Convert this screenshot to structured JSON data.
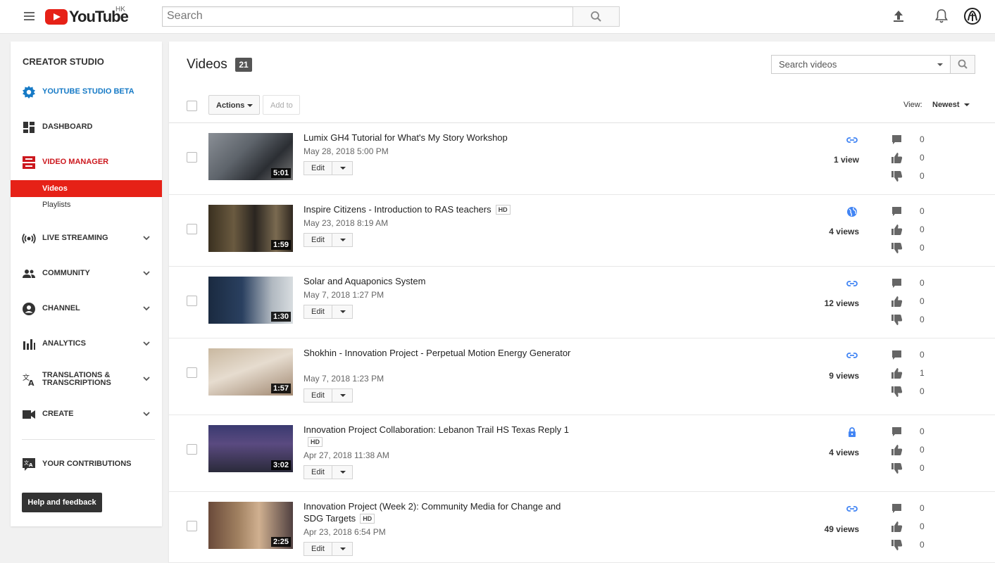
{
  "header": {
    "logo_text": "YouTube",
    "region": "HK",
    "search_placeholder": "Search"
  },
  "sidebar": {
    "title": "CREATOR STUDIO",
    "studio_beta": "YOUTUBE STUDIO BETA",
    "dashboard": "DASHBOARD",
    "video_manager": "VIDEO MANAGER",
    "videos": "Videos",
    "playlists": "Playlists",
    "live_streaming": "LIVE STREAMING",
    "community": "COMMUNITY",
    "channel": "CHANNEL",
    "analytics": "ANALYTICS",
    "translations_line1": "TRANSLATIONS &",
    "translations_line2": "TRANSCRIPTIONS",
    "create": "CREATE",
    "your_contributions": "YOUR CONTRIBUTIONS",
    "help_feedback": "Help and feedback"
  },
  "main": {
    "title": "Videos",
    "count": "21",
    "search_videos_placeholder": "Search videos",
    "actions_label": "Actions",
    "add_to_label": "Add to",
    "view_label": "View:",
    "view_value": "Newest",
    "edit_label": "Edit",
    "hd_label": "HD"
  },
  "videos": [
    {
      "title": "Lumix GH4 Tutorial for What's My Story Workshop",
      "hd": false,
      "date": "May 28, 2018 5:00 PM",
      "duration": "5:01",
      "privacy": "unlisted",
      "views": "1 view",
      "comments": "0",
      "likes": "0",
      "dislikes": "0"
    },
    {
      "title": "Inspire Citizens - Introduction to RAS teachers",
      "hd": true,
      "date": "May 23, 2018 8:19 AM",
      "duration": "1:59",
      "privacy": "public",
      "views": "4 views",
      "comments": "0",
      "likes": "0",
      "dislikes": "0"
    },
    {
      "title": "Solar and Aquaponics System",
      "hd": false,
      "date": "May 7, 2018 1:27 PM",
      "duration": "1:30",
      "privacy": "unlisted",
      "views": "12 views",
      "comments": "0",
      "likes": "0",
      "dislikes": "0"
    },
    {
      "title": "Shokhin - Innovation Project - Perpetual Motion Energy Generator",
      "hd": false,
      "date": "May 7, 2018 1:23 PM",
      "duration": "1:57",
      "privacy": "unlisted",
      "views": "9 views",
      "comments": "0",
      "likes": "1",
      "dislikes": "0"
    },
    {
      "title": "Innovation Project Collaboration: Lebanon Trail HS Texas Reply 1",
      "hd": true,
      "date": "Apr 27, 2018 11:38 AM",
      "duration": "3:02",
      "privacy": "private",
      "views": "4 views",
      "comments": "0",
      "likes": "0",
      "dislikes": "0"
    },
    {
      "title": "Innovation Project (Week 2): Community Media for Change and SDG Targets",
      "hd": true,
      "date": "Apr 23, 2018 6:54 PM",
      "duration": "2:25",
      "privacy": "unlisted",
      "views": "49 views",
      "comments": "0",
      "likes": "0",
      "dislikes": "0"
    }
  ],
  "colors": {
    "brand_red": "#e62117",
    "link_blue": "#167ac6",
    "privacy_blue": "#4285f4"
  }
}
